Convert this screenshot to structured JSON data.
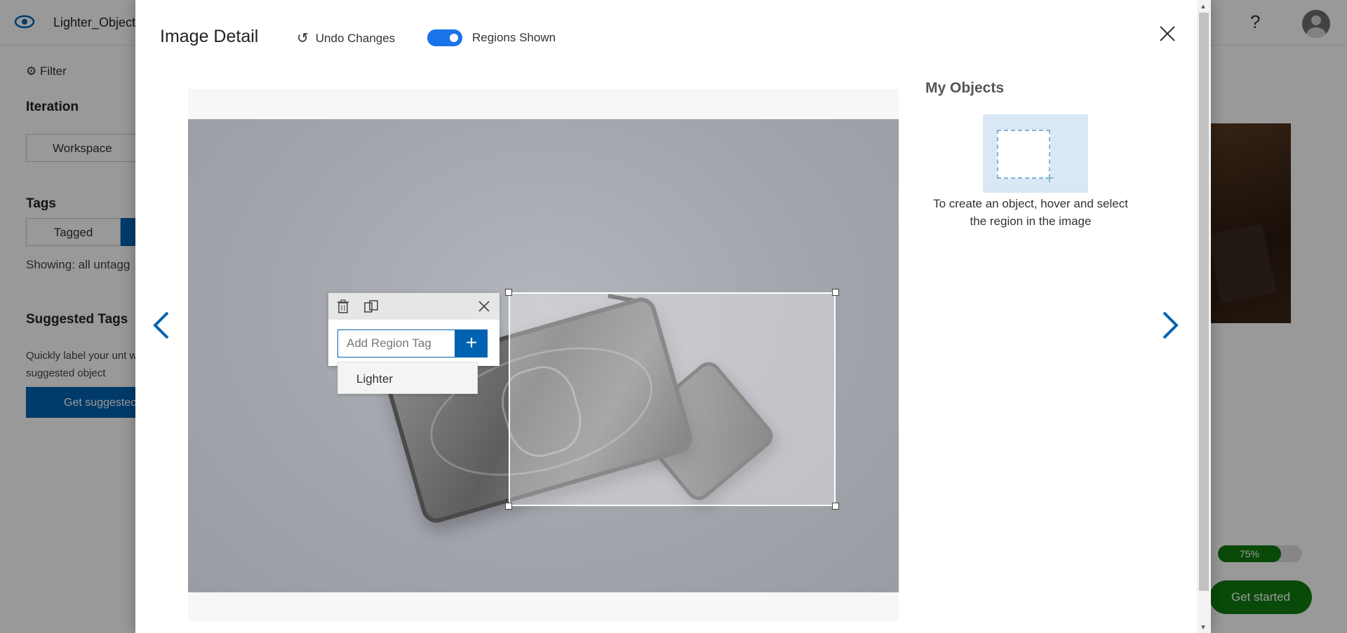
{
  "app": {
    "project_name": "Lighter_Object",
    "help_label": "?",
    "filter_label": "Filter",
    "iteration_heading": "Iteration",
    "iteration_value": "Workspace",
    "tags_heading": "Tags",
    "tagged_label": "Tagged",
    "showing_text": "Showing: all untagg",
    "suggested_heading": "Suggested Tags",
    "suggested_desc": "Quickly label your unt with suggested object",
    "get_suggested_label": "Get suggestec",
    "progress_percent": "75%",
    "progress_value": 0.75,
    "get_started_label": "Get started"
  },
  "modal": {
    "title": "Image Detail",
    "undo_label": "Undo Changes",
    "regions_toggle_label": "Regions Shown",
    "regions_toggle_on": true,
    "close_icon": "close-icon"
  },
  "region_editor": {
    "input_placeholder": "Add Region Tag",
    "input_value": "",
    "add_label": "+",
    "suggestion": "Lighter",
    "icons": [
      "trash-icon",
      "duplicate-icon",
      "close-icon"
    ]
  },
  "objects_panel": {
    "heading": "My Objects",
    "instruction": "To create an object, hover and select the region in the image"
  },
  "colors": {
    "accent_blue": "#0063b1",
    "toggle_blue": "#1a73e8",
    "success_green": "#107c10"
  }
}
